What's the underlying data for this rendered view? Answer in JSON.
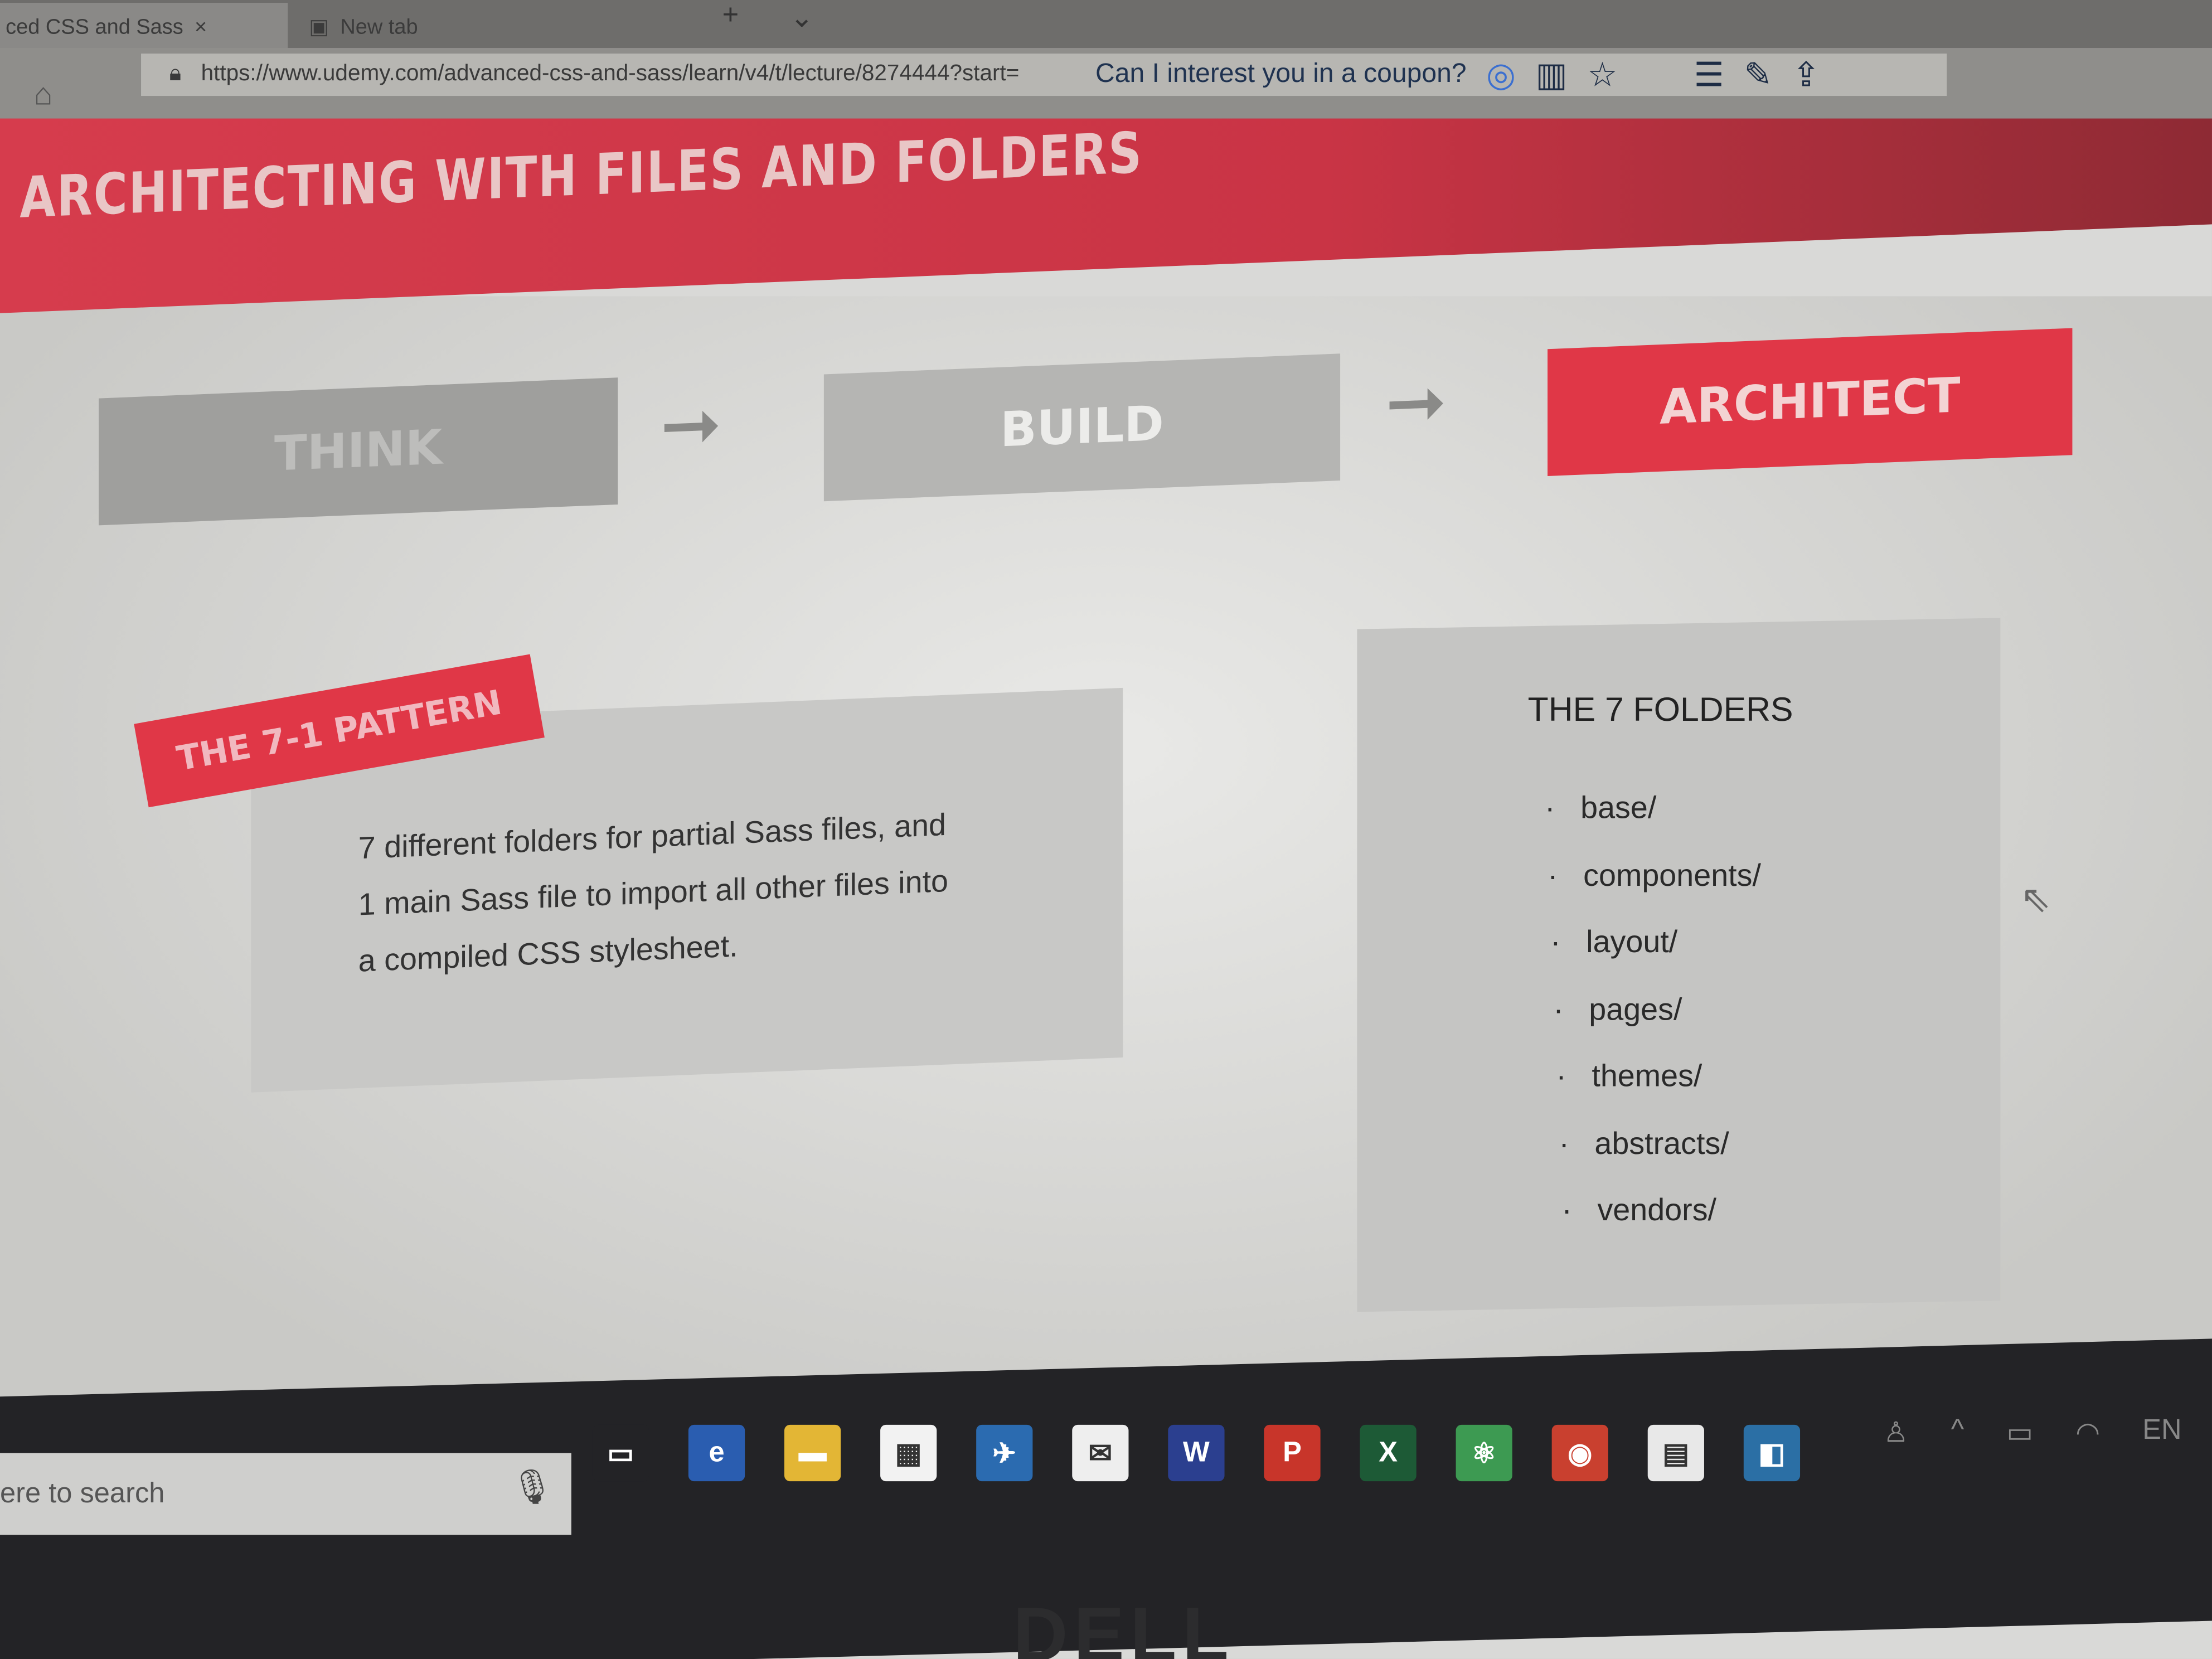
{
  "browser": {
    "tabs": [
      {
        "label": "ced CSS and Sass",
        "close": "×"
      },
      {
        "label": "New tab"
      }
    ],
    "new_tab": "+",
    "tab_menu": "⌄",
    "url": "https://www.udemy.com/advanced-css-and-sass/learn/v4/t/lecture/8274444?start=",
    "coupon": "Can I interest you in a coupon?"
  },
  "slide": {
    "title": "ARCHITECTING WITH FILES AND FOLDERS",
    "steps": [
      "THINK",
      "BUILD",
      "ARCHITECT"
    ],
    "arrow": "➞",
    "pattern_label": "THE 7-1 PATTERN",
    "description": [
      "7 different folders for partial Sass files, and",
      "1 main Sass file to import all other files into",
      "a compiled CSS stylesheet."
    ],
    "folders_title": "THE 7 FOLDERS",
    "folders": [
      "base/",
      "components/",
      "layout/",
      "pages/",
      "themes/",
      "abstracts/",
      "vendors/"
    ],
    "bullet": "·"
  },
  "taskbar": {
    "search": "ere to search",
    "apps": [
      {
        "name": "task-view",
        "glyph": "▭",
        "color": "#232326"
      },
      {
        "name": "edge",
        "glyph": "e",
        "color": "#2a5db0"
      },
      {
        "name": "file-explorer",
        "glyph": "▬",
        "color": "#e3b635"
      },
      {
        "name": "store",
        "glyph": "▦",
        "color": "#f2f2f2"
      },
      {
        "name": "app-blue",
        "glyph": "✈",
        "color": "#2b6bb0"
      },
      {
        "name": "mail",
        "glyph": "✉",
        "color": "#eeeeee"
      },
      {
        "name": "word",
        "glyph": "W",
        "color": "#2b3f8f"
      },
      {
        "name": "powerpoint",
        "glyph": "P",
        "color": "#c8352a"
      },
      {
        "name": "excel",
        "glyph": "X",
        "color": "#1d5a36"
      },
      {
        "name": "atom",
        "glyph": "⚛",
        "color": "#3d9a52"
      },
      {
        "name": "chrome",
        "glyph": "◉",
        "color": "#c9402f"
      },
      {
        "name": "calculator",
        "glyph": "▤",
        "color": "#e8e8e8"
      },
      {
        "name": "app-window",
        "glyph": "◧",
        "color": "#2b6fa5"
      }
    ],
    "tray": [
      "♙",
      "^",
      "▭",
      "◠",
      "EN"
    ]
  },
  "bezel_logo": "DELL",
  "colors": {
    "accent": "#e03747"
  }
}
